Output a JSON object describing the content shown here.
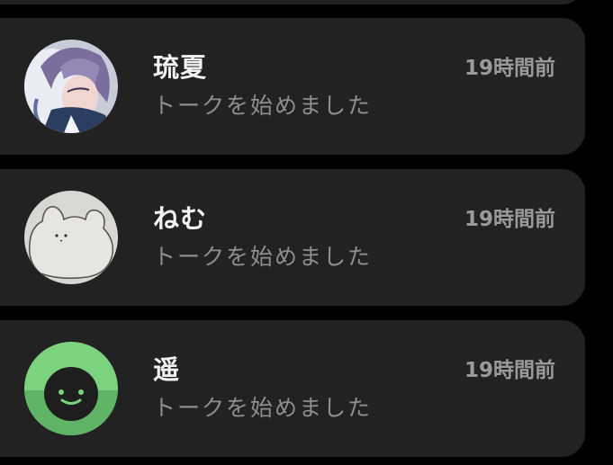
{
  "colors": {
    "background": "#000000",
    "card": "#222222",
    "name_text": "#f2f2f2",
    "secondary_text": "#8e8e8e",
    "green_avatar": "#7bd27f"
  },
  "chats": [
    {
      "name": "琉夏",
      "time": "19時間前",
      "last_message": "トークを始めました",
      "avatar_icon": "anime-character-avatar-icon"
    },
    {
      "name": "ねむ",
      "time": "19時間前",
      "last_message": "トークを始めました",
      "avatar_icon": "frog-sketch-avatar-icon"
    },
    {
      "name": "遥",
      "time": "19時間前",
      "last_message": "トークを始めました",
      "avatar_icon": "green-smiley-avatar-icon"
    }
  ]
}
